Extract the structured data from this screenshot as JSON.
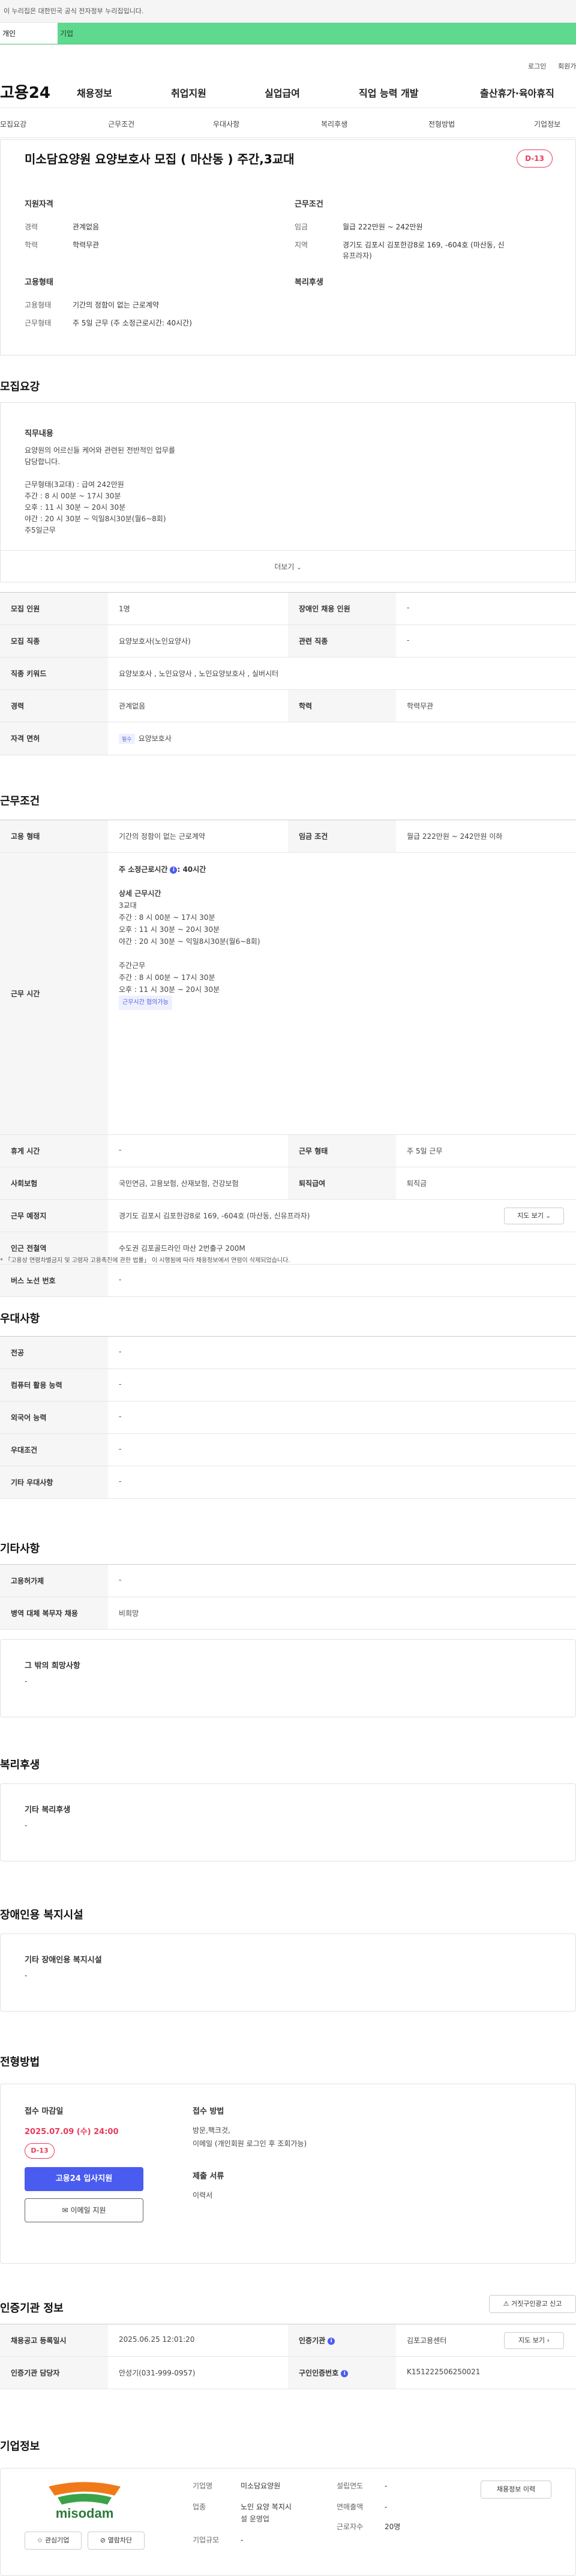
{
  "top_notice": "이 누리집은 대한민국 공식 전자정부 누리집입니다.",
  "tabs": [
    {
      "label": "개인"
    },
    {
      "label": "기업"
    }
  ],
  "util": {
    "login": "로그인",
    "signup": "회원가입"
  },
  "logo": "고용24",
  "gnb": [
    "채용정보",
    "취업지원",
    "실업급여",
    "직업 능력 개발",
    "출산휴가·육아휴직"
  ],
  "lnb": [
    "모집요강",
    "근무조건",
    "우대사항",
    "복리후생",
    "전형방법",
    "기업정보"
  ],
  "summary": {
    "title": "미소담요양원 요양보호사 모집 ( 마산동 ) 주간,3교대",
    "dday": "D-13",
    "qual_h": "지원자격",
    "cond_h": "근무조건",
    "emp_h": "고용형태",
    "welfare_h": "복리후생",
    "career_k": "경력",
    "career_v": "관계없음",
    "edu_k": "학력",
    "edu_v": "학력무관",
    "wage_k": "임금",
    "wage_v": "월급 222만원 ~ 242만원",
    "region_k": "지역",
    "region_v1": "경기도 김포시 김포한강8로 169, -604호 (마산동, 신",
    "region_v2": "유프라자)",
    "emptype_k": "고용형태",
    "emptype_v": "기간의 정함이 없는 근로계약",
    "worktype_k": "근무형태",
    "worktype_v": "주 5일 근무 (주 소정근로시간: 40시간)"
  },
  "recruit": {
    "title": "모집요강",
    "duty_h": "직무내용",
    "duty_lines": [
      "요양원의 어르신들  케어와  관련된 전반적인 업무를",
      "담당합니다.",
      "",
      "근무형태(3교대) : 급여 242만원",
      "주간 :   8 시 00분 ~ 17시 30분",
      "오후 : 11 시 30분 ~ 20시 30분",
      "야간 : 20 시 30분 ~ 익일8시30분(월6~8회)",
      "주5일근무"
    ],
    "more": "더보기",
    "rows": [
      {
        "k1": "모집 인원",
        "v1": "1명",
        "k2": "장애인 채용 인원",
        "v2": "-"
      },
      {
        "k1": "모집 직종",
        "v1": "요양보호사(노인요양사)",
        "k2": "관련 직종",
        "v2": "-"
      },
      {
        "k1": "직종 키워드",
        "v1": "요양보호사 , 노인요양사 , 노인요양보호사 , 실버시터"
      },
      {
        "k1": "경력",
        "v1": "관계없음",
        "k2": "학력",
        "v2": "학력무관"
      },
      {
        "k1": "자격 면허",
        "chip": "필수",
        "v1": "요양보호사"
      }
    ]
  },
  "work": {
    "title": "근무조건",
    "emptype_k": "고용 형태",
    "emptype_v": "기간의 정함이 없는 근로계약",
    "wage_k": "임금 조건",
    "wage_v": "월급 222만원 ~ 242만원 이하",
    "hours_k": "근무 시간",
    "hours_main": "주 소정근로시간",
    "hours_main_v": ": 40시간",
    "hours_lines": [
      "상세 근무시간",
      "3교대",
      "주간 :   8 시 00분 ~ 17시 30분",
      "오후 : 11 시 30분 ~ 20시 30분",
      "야간 : 20 시 30분 ~ 익일8시30분(월6~8회)",
      "",
      "주간근무",
      "주간 :   8 시 00분 ~ 17시 30분",
      "오후 : 11 시 30분 ~ 20시 30분"
    ],
    "hours_tag": "근무시간 협의가능",
    "rest_k": "휴게 시간",
    "rest_v": "-",
    "form_k": "근무 형태",
    "form_v": "주 5일 근무",
    "ins_k": "사회보험",
    "ins_v": "국민연금, 고용보험, 산재보험, 건강보험",
    "retire_k": "퇴직급여",
    "retire_v": "퇴직금",
    "place_k": "근무 예정지",
    "place_v": "경기도 김포시 김포한강8로 169, -604호 (마산동, 신유프라자)",
    "map_btn": "지도 보기",
    "station_k": "인근 전철역",
    "station_v": "수도권 김포골드라인 마산 2번출구 200M",
    "bus_k": "버스 노선 번호",
    "bus_v": "-",
    "note": "* 「고용상 연령차별금지 및 고령자 고용촉진에 관한 법률」 이 시행됨에 따라 채용정보에서 연령이 삭제되었습니다."
  },
  "pref": {
    "title": "우대사항",
    "rows": [
      {
        "k": "전공",
        "v": "-"
      },
      {
        "k": "컴퓨터 활용 능력",
        "v": "-"
      },
      {
        "k": "외국어 능력",
        "v": "-"
      },
      {
        "k": "우대조건",
        "v": "-"
      },
      {
        "k": "기타 우대사항",
        "v": "-"
      }
    ]
  },
  "etc": {
    "title": "기타사항",
    "rows": [
      {
        "k": "고용허가제",
        "v": "-"
      },
      {
        "k": "병역 대체 복무자 채용",
        "v": "비희망"
      }
    ],
    "other_h": "그 밖의 희망사항",
    "other_v": "-"
  },
  "welfare": {
    "title": "복리후생",
    "box_h": "기타 복리후생",
    "box_v": "-"
  },
  "disab": {
    "title": "장애인용 복지시설",
    "box_h": "기타 장애인용 복지시설",
    "box_v": "-"
  },
  "apply": {
    "title": "전형방법",
    "deadline_h": "접수 마감일",
    "deadline_v": "2025.07.09 (수) 24:00",
    "dday": "D-13",
    "apply_btn": "고용24 입사지원",
    "email_btn": "이메일 지원",
    "method_h": "접수 방법",
    "method_v1": "방문,팩크것,",
    "method_v2": "이메일 (개인회원 로그인 후 조회가능)",
    "docs_h": "제출 서류",
    "docs_v": "이력서"
  },
  "agency": {
    "title": "인증기관 정보",
    "report_btn": "거짓구인광고 신고",
    "reg_k": "채용공고 등록일시",
    "reg_v": "2025.06.25 12:01:20",
    "org_k": "인증기관",
    "org_v": "김포고용센터",
    "map_btn": "지도 보기",
    "mgr_k": "인증기관 담당자",
    "mgr_v": "안성기(031-999-0957)",
    "no_k": "구인인증번호",
    "no_v": "K151222506250021"
  },
  "company": {
    "title": "기업정보",
    "logo_text": "misodam",
    "name_k": "기업명",
    "name_v": "미소담요양원",
    "ind_k": "업종",
    "ind_v1": "노인 요양 복지시",
    "ind_v2": "설 운영업",
    "size_k": "기업규모",
    "size_v": "-",
    "est_k": "설립연도",
    "est_v": "-",
    "sales_k": "연매출액",
    "sales_v": "-",
    "emp_k": "근로자수",
    "emp_v": "20명",
    "history_btn": "채용정보 이력",
    "fav_btn": "관심기업",
    "block_btn": "열람차단"
  }
}
